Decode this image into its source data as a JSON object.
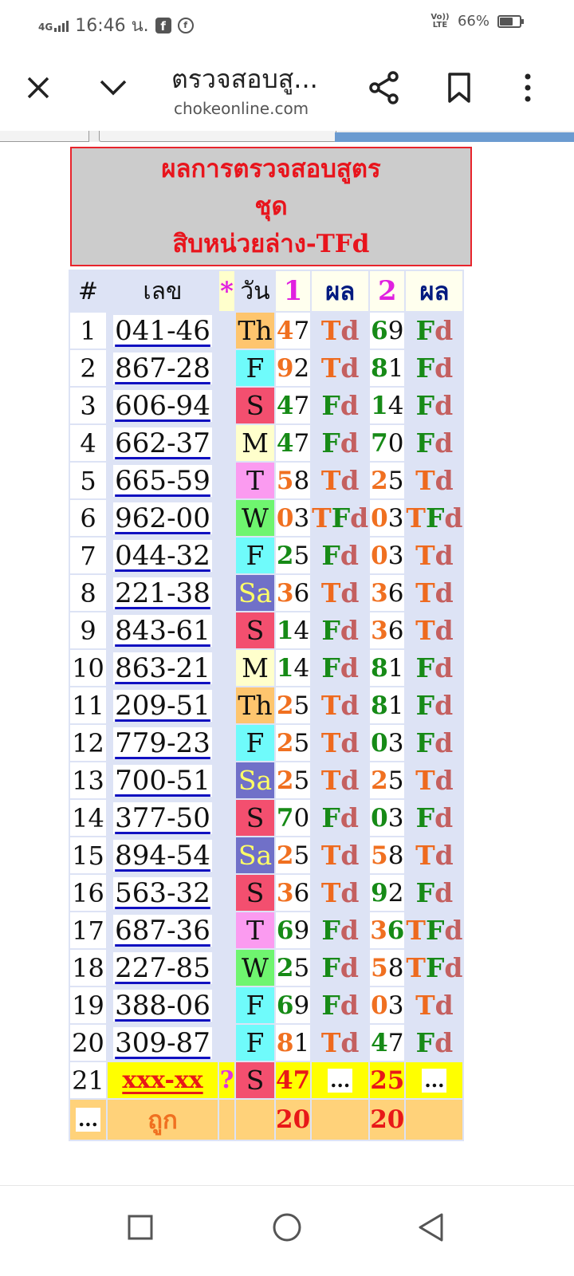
{
  "status_bar": {
    "network": "4G",
    "time": "16:46 น.",
    "volte": "Vo)) LTE",
    "battery_percent": "66%",
    "battery_level": 0.66
  },
  "browser": {
    "title": "ตรวจสอบสู...",
    "url": "chokeonline.com",
    "icons": [
      "close-icon",
      "chevron-down-icon",
      "share-icon",
      "bookmark-icon",
      "more-vertical-icon"
    ]
  },
  "header": {
    "line1": "ผลการตรวจสอบสูตร",
    "line2": "ชุด",
    "line3": "สิบหน่วยล่าง-TFd"
  },
  "table": {
    "columns": [
      "#",
      "เลข",
      "*",
      "วัน",
      "1",
      "ผล",
      "2",
      "ผล"
    ],
    "rows": [
      {
        "n": "1",
        "num": "041-46",
        "day": "Th",
        "v1": "47",
        "r1": "Td",
        "v2": "69",
        "r2": "Fd"
      },
      {
        "n": "2",
        "num": "867-28",
        "day": "F",
        "v1": "92",
        "r1": "Td",
        "v2": "81",
        "r2": "Fd"
      },
      {
        "n": "3",
        "num": "606-94",
        "day": "S",
        "v1": "47",
        "r1": "Fd",
        "v2": "14",
        "r2": "Fd"
      },
      {
        "n": "4",
        "num": "662-37",
        "day": "M",
        "v1": "47",
        "r1": "Fd",
        "v2": "70",
        "r2": "Fd"
      },
      {
        "n": "5",
        "num": "665-59",
        "day": "T",
        "v1": "58",
        "r1": "Td",
        "v2": "25",
        "r2": "Td"
      },
      {
        "n": "6",
        "num": "962-00",
        "day": "W",
        "v1": "03",
        "r1": "TFd",
        "v2": "03",
        "r2": "TFd"
      },
      {
        "n": "7",
        "num": "044-32",
        "day": "F",
        "v1": "25",
        "r1": "Fd",
        "v2": "03",
        "r2": "Td"
      },
      {
        "n": "8",
        "num": "221-38",
        "day": "Sa",
        "v1": "36",
        "r1": "Td",
        "v2": "36",
        "r2": "Td"
      },
      {
        "n": "9",
        "num": "843-61",
        "day": "S",
        "v1": "14",
        "r1": "Fd",
        "v2": "36",
        "r2": "Td"
      },
      {
        "n": "10",
        "num": "863-21",
        "day": "M",
        "v1": "14",
        "r1": "Fd",
        "v2": "81",
        "r2": "Fd"
      },
      {
        "n": "11",
        "num": "209-51",
        "day": "Th",
        "v1": "25",
        "r1": "Td",
        "v2": "81",
        "r2": "Fd"
      },
      {
        "n": "12",
        "num": "779-23",
        "day": "F",
        "v1": "25",
        "r1": "Td",
        "v2": "03",
        "r2": "Fd"
      },
      {
        "n": "13",
        "num": "700-51",
        "day": "Sa",
        "v1": "25",
        "r1": "Td",
        "v2": "25",
        "r2": "Td"
      },
      {
        "n": "14",
        "num": "377-50",
        "day": "S",
        "v1": "70",
        "r1": "Fd",
        "v2": "03",
        "r2": "Fd"
      },
      {
        "n": "15",
        "num": "894-54",
        "day": "Sa",
        "v1": "25",
        "r1": "Td",
        "v2": "58",
        "r2": "Td"
      },
      {
        "n": "16",
        "num": "563-32",
        "day": "S",
        "v1": "36",
        "r1": "Td",
        "v2": "92",
        "r2": "Fd"
      },
      {
        "n": "17",
        "num": "687-36",
        "day": "T",
        "v1": "69",
        "r1": "Fd",
        "v2": "36",
        "r2": "TFd"
      },
      {
        "n": "18",
        "num": "227-85",
        "day": "W",
        "v1": "25",
        "r1": "Fd",
        "v2": "58",
        "r2": "TFd"
      },
      {
        "n": "19",
        "num": "388-06",
        "day": "F",
        "v1": "69",
        "r1": "Fd",
        "v2": "03",
        "r2": "Td"
      },
      {
        "n": "20",
        "num": "309-87",
        "day": "F",
        "v1": "81",
        "r1": "Td",
        "v2": "47",
        "r2": "Fd"
      }
    ],
    "prediction": {
      "n": "21",
      "num": "xxx-xx",
      "q": "?",
      "day": "S",
      "v1": "47",
      "r1": "...",
      "v2": "25",
      "r2": "..."
    },
    "total": {
      "n": "...",
      "label": "ถูก",
      "v1": "20",
      "v2": "20"
    }
  },
  "colors": {
    "day_Th": "#fec56e",
    "day_F": "#6ffbfb",
    "day_S": "#f34f6f",
    "day_M": "#ffffcc",
    "day_T": "#fb9bf0",
    "day_W": "#6ff56f",
    "day_Sa": "#7070c8",
    "highlight_orange": "#f07020",
    "highlight_green": "#168a16",
    "header_red": "#e8141c",
    "table_bg": "#dde3f5",
    "prediction_bg": "#ffff00",
    "total_bg": "#ffd27a"
  },
  "nav_bar": {
    "icons": [
      "recent-apps-icon",
      "home-icon",
      "back-icon"
    ]
  }
}
